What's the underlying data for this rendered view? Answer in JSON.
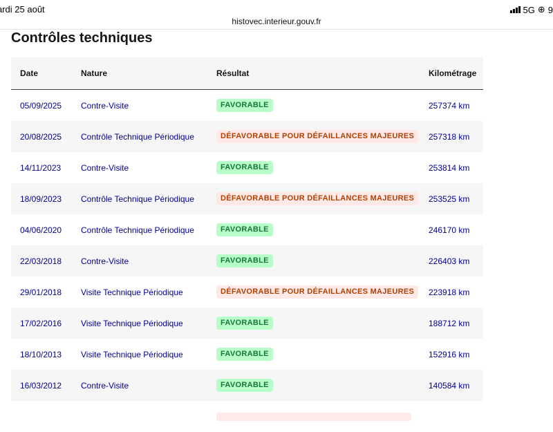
{
  "status": {
    "time": "ardi 25 août",
    "network": "5G",
    "battery": "9"
  },
  "browser": {
    "url": "histovec.interieur.gouv.fr"
  },
  "section": {
    "title": "Contrôles techniques"
  },
  "table": {
    "headers": {
      "date": "Date",
      "nature": "Nature",
      "result": "Résultat",
      "mileage": "Kilométrage"
    },
    "rows": [
      {
        "date": "05/09/2025",
        "nature": "Contre-Visite",
        "result": "FAVORABLE",
        "status": "fav",
        "mileage": "257374 km"
      },
      {
        "date": "20/08/2025",
        "nature": "Contrôle Technique Périodique",
        "result": "DÉFAVORABLE POUR DÉFAILLANCES MAJEURES",
        "status": "def",
        "mileage": "257318 km"
      },
      {
        "date": "14/11/2023",
        "nature": "Contre-Visite",
        "result": "FAVORABLE",
        "status": "fav",
        "mileage": "253814 km"
      },
      {
        "date": "18/09/2023",
        "nature": "Contrôle Technique Périodique",
        "result": "DÉFAVORABLE POUR DÉFAILLANCES MAJEURES",
        "status": "def",
        "mileage": "253525 km"
      },
      {
        "date": "04/06/2020",
        "nature": "Contrôle Technique Périodique",
        "result": "FAVORABLE",
        "status": "fav",
        "mileage": "246170 km"
      },
      {
        "date": "22/03/2018",
        "nature": "Contre-Visite",
        "result": "FAVORABLE",
        "status": "fav",
        "mileage": "226403 km"
      },
      {
        "date": "29/01/2018",
        "nature": "Visite Technique Périodique",
        "result": "DÉFAVORABLE POUR DÉFAILLANCES MAJEURES",
        "status": "def",
        "mileage": "223918 km"
      },
      {
        "date": "17/02/2016",
        "nature": "Visite Technique Périodique",
        "result": "FAVORABLE",
        "status": "fav",
        "mileage": "188712 km"
      },
      {
        "date": "18/10/2013",
        "nature": "Visite Technique Périodique",
        "result": "FAVORABLE",
        "status": "fav",
        "mileage": "152916 km"
      },
      {
        "date": "16/03/2012",
        "nature": "Contre-Visite",
        "result": "FAVORABLE",
        "status": "fav",
        "mileage": "140584 km"
      },
      {
        "date": "",
        "nature": "",
        "result": "",
        "status": "def",
        "mileage": ""
      }
    ]
  },
  "colors": {
    "link": "#000091",
    "favorable_bg": "#b8fec9",
    "favorable_text": "#18753c",
    "defavorable_bg": "#ffe9e6",
    "defavorable_text": "#b34000"
  }
}
